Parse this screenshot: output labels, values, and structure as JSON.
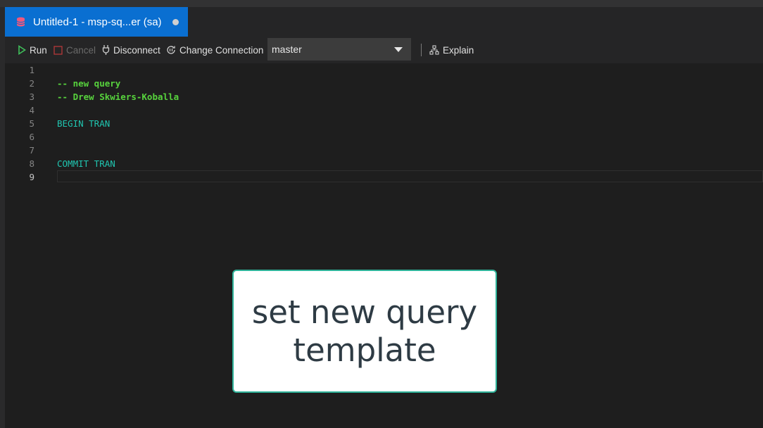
{
  "tab": {
    "title": "Untitled-1 - msp-sq...er (sa)",
    "icon": "database-icon",
    "dirty": true
  },
  "toolbar": {
    "run_label": "Run",
    "cancel_label": "Cancel",
    "disconnect_label": "Disconnect",
    "change_connection_label": "Change Connection",
    "database_selected": "master",
    "explain_label": "Explain"
  },
  "editor": {
    "lines": [
      {
        "n": "1",
        "text": "",
        "kind": "plain"
      },
      {
        "n": "2",
        "text": "-- new query",
        "kind": "comment"
      },
      {
        "n": "3",
        "text": "-- Drew Skwiers-Koballa",
        "kind": "comment"
      },
      {
        "n": "4",
        "text": "",
        "kind": "plain"
      },
      {
        "n": "5",
        "text": "BEGIN TRAN",
        "kind": "keyword"
      },
      {
        "n": "6",
        "text": "",
        "kind": "plain"
      },
      {
        "n": "7",
        "text": "",
        "kind": "plain"
      },
      {
        "n": "8",
        "text": "COMMIT TRAN",
        "kind": "keyword"
      },
      {
        "n": "9",
        "text": "",
        "kind": "plain"
      }
    ],
    "active_line": "9"
  },
  "callout": {
    "line1": "set new query",
    "line2": "template"
  },
  "colors": {
    "tab_active": "#0a6fd1",
    "comment": "#57d23d",
    "keyword": "#20c5b0",
    "callout_border": "#2fb39a"
  }
}
